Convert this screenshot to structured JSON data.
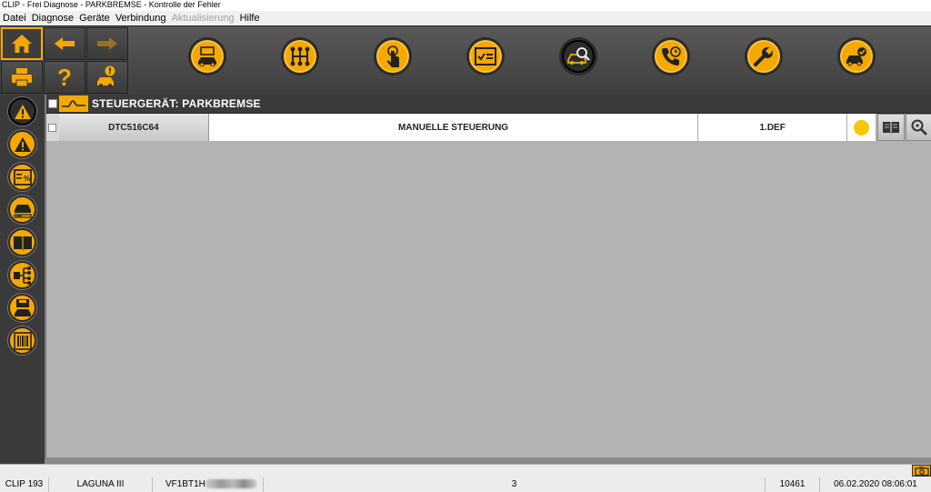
{
  "window": {
    "title": "CLIP - Frei Diagnose - PARKBREMSE - Kontrolle der Fehler"
  },
  "menu": [
    {
      "label": "Datei",
      "disabled": false
    },
    {
      "label": "Diagnose",
      "disabled": false
    },
    {
      "label": "Geräte",
      "disabled": false
    },
    {
      "label": "Verbindung",
      "disabled": false
    },
    {
      "label": "Aktualisierung",
      "disabled": true
    },
    {
      "label": "Hilfe",
      "disabled": false
    }
  ],
  "colors": {
    "accent": "#f5a800",
    "toolbar": "#4a4a4a",
    "workspace": "#b3b3b3",
    "status_dot": "#f8c700"
  },
  "nav_buttons": [
    "home-icon",
    "back-arrow-icon",
    "forward-arrow-icon",
    "printer-icon",
    "help-question-icon",
    "vehicle-alert-icon"
  ],
  "toolbar_buttons": [
    {
      "name": "vehicle-identification-icon",
      "active": false
    },
    {
      "name": "gearbox-icon",
      "active": false
    },
    {
      "name": "touch-test-icon",
      "active": false
    },
    {
      "name": "checklist-icon",
      "active": false
    },
    {
      "name": "vehicle-scan-icon",
      "active": true
    },
    {
      "name": "phone-support-icon",
      "active": false
    },
    {
      "name": "wrench-icon",
      "active": false
    },
    {
      "name": "vehicle-check-icon",
      "active": false
    }
  ],
  "side_buttons": [
    {
      "name": "fault-warning-icon",
      "active": true
    },
    {
      "name": "warning-icon",
      "active": false
    },
    {
      "name": "parameters-percent-icon",
      "active": false
    },
    {
      "name": "vehicle-config-icon",
      "active": false
    },
    {
      "name": "manual-book-icon",
      "active": false
    },
    {
      "name": "network-tree-icon",
      "active": false
    },
    {
      "name": "save-vehicle-icon",
      "active": false
    },
    {
      "name": "barcode-icon",
      "active": false
    }
  ],
  "header": {
    "title": "STEUERGERÄT: PARKBREMSE"
  },
  "faults": [
    {
      "code": "DTC516C64",
      "description": "MANUELLE STEUERUNG",
      "status": "1.DEF"
    }
  ],
  "statusbar": {
    "clip": "CLIP 193",
    "vehicle": "LAGUNA III",
    "vin_prefix": "VF1BT1H",
    "count": "3",
    "code": "10461",
    "datetime": "06.02.2020 08:06:01"
  }
}
